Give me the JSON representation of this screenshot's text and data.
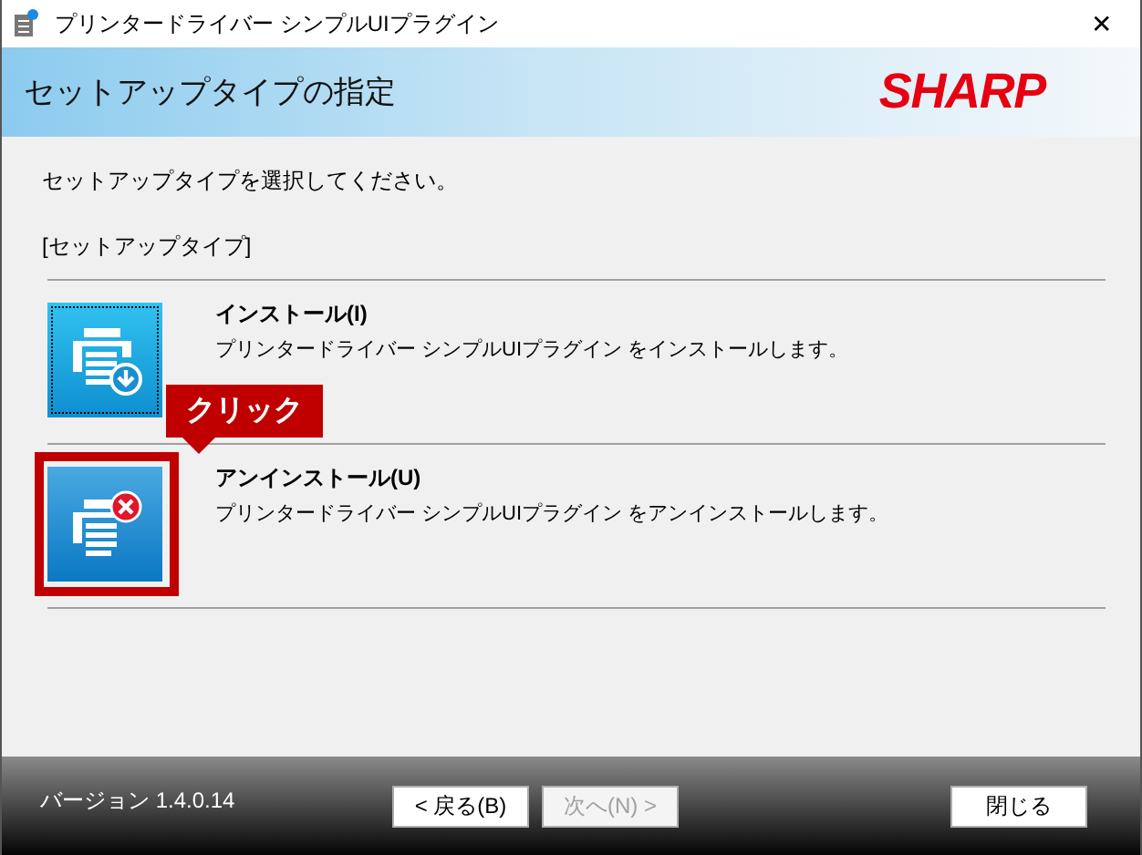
{
  "window": {
    "title": "プリンタードライバー シンプルUIプラグイン",
    "close": "✕"
  },
  "header": {
    "title": "セットアップタイプの指定",
    "logo": "SHARP"
  },
  "instruction": "セットアップタイプを選択してください。",
  "section_label": "[セットアップタイプ]",
  "options": [
    {
      "kind": "install",
      "title": "インストール(I)",
      "description": "プリンタードライバー シンプルUIプラグイン をインストールします。",
      "focused": true,
      "highlighted": false
    },
    {
      "kind": "uninstall",
      "title": "アンインストール(U)",
      "description": "プリンタードライバー シンプルUIプラグイン をアンインストールします。",
      "focused": false,
      "highlighted": true
    }
  ],
  "callout": "クリック",
  "footer": {
    "version": "バージョン 1.4.0.14",
    "buttons": [
      {
        "label": "< 戻る(B)",
        "disabled": false
      },
      {
        "label": "次へ(N) >",
        "disabled": true
      },
      {
        "label": "閉じる",
        "disabled": false
      }
    ]
  }
}
